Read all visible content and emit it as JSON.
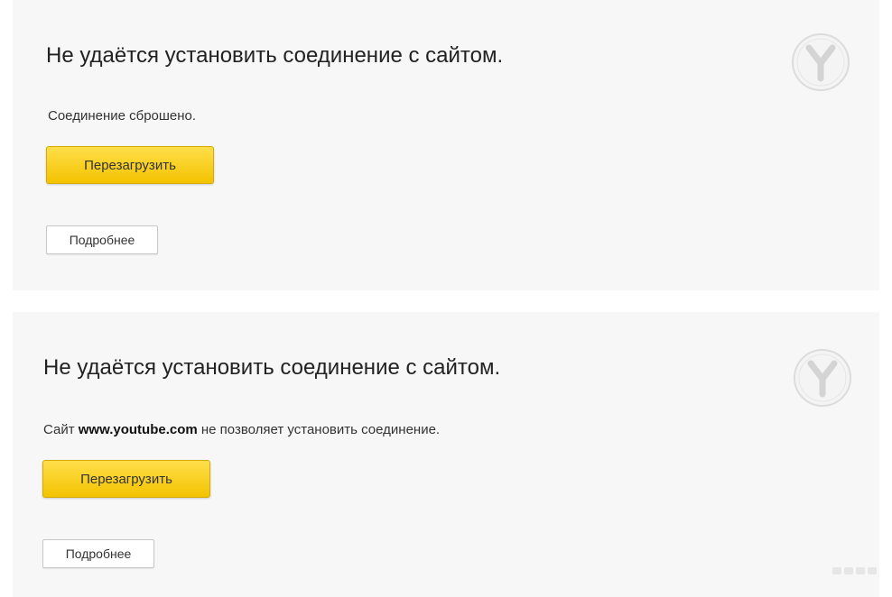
{
  "errors": [
    {
      "heading": "Не удаётся установить соединение с сайтом.",
      "message": "Соединение сброшено.",
      "reload_label": "Перезагрузить",
      "details_label": "Подробнее",
      "logo_icon": "yandex-browser-logo-icon"
    },
    {
      "heading": "Не удаётся установить соединение с сайтом.",
      "message_prefix": "Сайт ",
      "site": "www.youtube.com",
      "message_suffix": " не позволяет установить соединение.",
      "reload_label": "Перезагрузить",
      "details_label": "Подробнее",
      "logo_icon": "yandex-browser-logo-icon"
    }
  ],
  "colors": {
    "reload_button": "#f5c800",
    "panel_background": "#f7f7f7",
    "heading_text": "#222222"
  }
}
